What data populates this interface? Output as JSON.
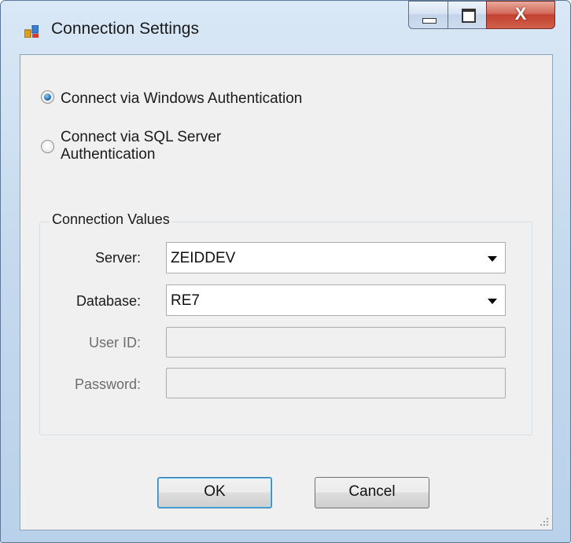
{
  "window": {
    "title": "Connection Settings",
    "close_glyph": "X"
  },
  "auth": {
    "windows_label": "Connect via Windows Authentication",
    "sql_label_line1": "Connect via SQL Server",
    "sql_label_line2": "Authentication",
    "selected": "windows"
  },
  "connection_values": {
    "caption": "Connection Values",
    "server_label": "Server:",
    "server_value": "ZEIDDEV",
    "database_label": "Database:",
    "database_value": "RE7",
    "userid_label": "User ID:",
    "userid_value": "",
    "password_label": "Password:",
    "password_value": ""
  },
  "buttons": {
    "ok_label": "OK",
    "cancel_label": "Cancel"
  },
  "icons": [
    "app-icon",
    "minimize-icon",
    "maximize-icon",
    "close-icon",
    "chevron-down-icon",
    "resize-grip-icon"
  ]
}
